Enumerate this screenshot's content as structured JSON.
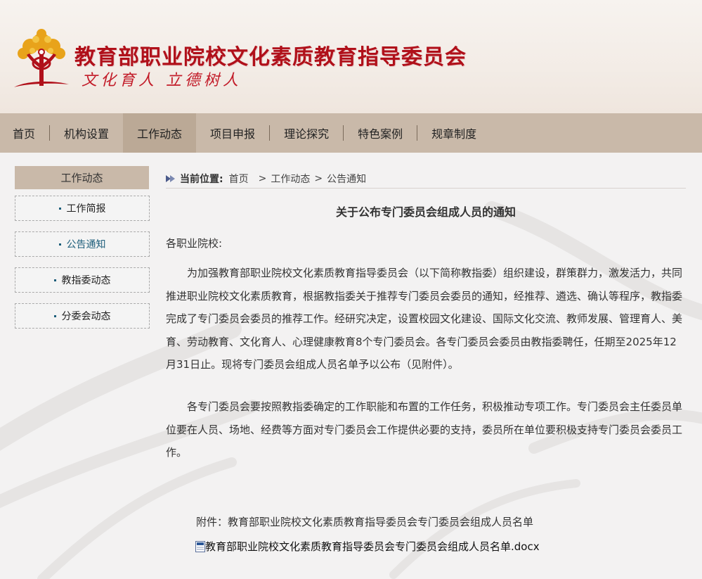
{
  "header": {
    "site_title": "教育部职业院校文化素质教育指导委员会",
    "slogan": "文化育人  立德树人"
  },
  "nav": {
    "items": [
      "首页",
      "机构设置",
      "工作动态",
      "项目申报",
      "理论探究",
      "特色案例",
      "规章制度"
    ],
    "active": "工作动态"
  },
  "sidebar": {
    "heading": "工作动态",
    "items": [
      {
        "label": "工作简报"
      },
      {
        "label": "公告通知"
      },
      {
        "label": "教指委动态"
      },
      {
        "label": "分委会动态"
      }
    ],
    "active": "公告通知"
  },
  "breadcrumb": {
    "lead": "当前位置:",
    "home": "首页",
    "gt": ">",
    "section": "工作动态",
    "page": "公告通知"
  },
  "article": {
    "title": "关于公布专门委员会组成人员的通知",
    "greeting": "各职业院校:",
    "paragraphs": [
      "为加强教育部职业院校文化素质教育指导委员会（以下简称教指委）组织建设，群策群力，激发活力，共同推进职业院校文化素质教育，根据教指委关于推荐专门委员会委员的通知，经推荐、遴选、确认等程序，教指委完成了专门委员会委员的推荐工作。经研究决定，设置校园文化建设、国际文化交流、教师发展、管理育人、美育、劳动教育、文化育人、心理健康教育8个专门委员会。各专门委员会委员由教指委聘任，任期至2025年12月31日止。现将专门委员会组成人员名单予以公布（见附件）。",
      "各专门委员会要按照教指委确定的工作职能和布置的工作任务，积极推动专项工作。专门委员会主任委员单位要在人员、场地、经费等方面对专门委员会工作提供必要的支持，委员所在单位要积极支持专门委员会委员工作。"
    ],
    "attachment_label": "附件：教育部职业院校文化素质教育指导委员会专门委员会组成人员名单",
    "attachment_file": "教育部职业院校文化素质教育指导委员会专门委员会组成人员名单.docx"
  },
  "colors": {
    "brand_red": "#b0101a",
    "nav_bg": "#c9b9a9",
    "nav_active": "#bba996",
    "link_blue": "#1c5d7a"
  }
}
